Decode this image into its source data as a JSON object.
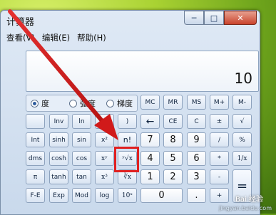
{
  "window": {
    "title": "计算器",
    "caption": {
      "minimize": "─",
      "maximize": "□",
      "close": "✕"
    }
  },
  "menu": [
    "查看(V)",
    "编辑(E)",
    "帮助(H)"
  ],
  "display": {
    "value": "10"
  },
  "angle_modes": [
    {
      "label": "度",
      "selected": true
    },
    {
      "label": "弧度",
      "selected": false
    },
    {
      "label": "梯度",
      "selected": false
    }
  ],
  "keys": {
    "mc": "MC",
    "mr": "MR",
    "ms": "MS",
    "mplus": "M+",
    "mminus": "M-",
    "inv": "Inv",
    "ln": "ln",
    "lparen": "(",
    "rparen": ")",
    "back": "←",
    "ce": "CE",
    "c": "C",
    "neg": "±",
    "sqrt": "√",
    "int": "Int",
    "sinh": "sinh",
    "sin": "sin",
    "x2": "x²",
    "fact": "n!",
    "seven": "7",
    "eight": "8",
    "nine": "9",
    "div": "/",
    "pct": "%",
    "dms": "dms",
    "cosh": "cosh",
    "cos": "cos",
    "xy": "xʸ",
    "yroot": "ʸ√x",
    "four": "4",
    "five": "5",
    "six": "6",
    "mul": "*",
    "recip": "1/x",
    "pi": "π",
    "tanh": "tanh",
    "tan": "tan",
    "x3": "x³",
    "croot": "∛x",
    "one": "1",
    "two": "2",
    "three": "3",
    "sub": "-",
    "eq": "=",
    "fe": "F-E",
    "exp": "Exp",
    "mod": "Mod",
    "log": "log",
    "tenx": "10ˣ",
    "zero": "0",
    "dot": ".",
    "add": "+"
  },
  "watermark": {
    "text": "jingyan.baidu.com",
    "logo": "Bai 经验"
  }
}
